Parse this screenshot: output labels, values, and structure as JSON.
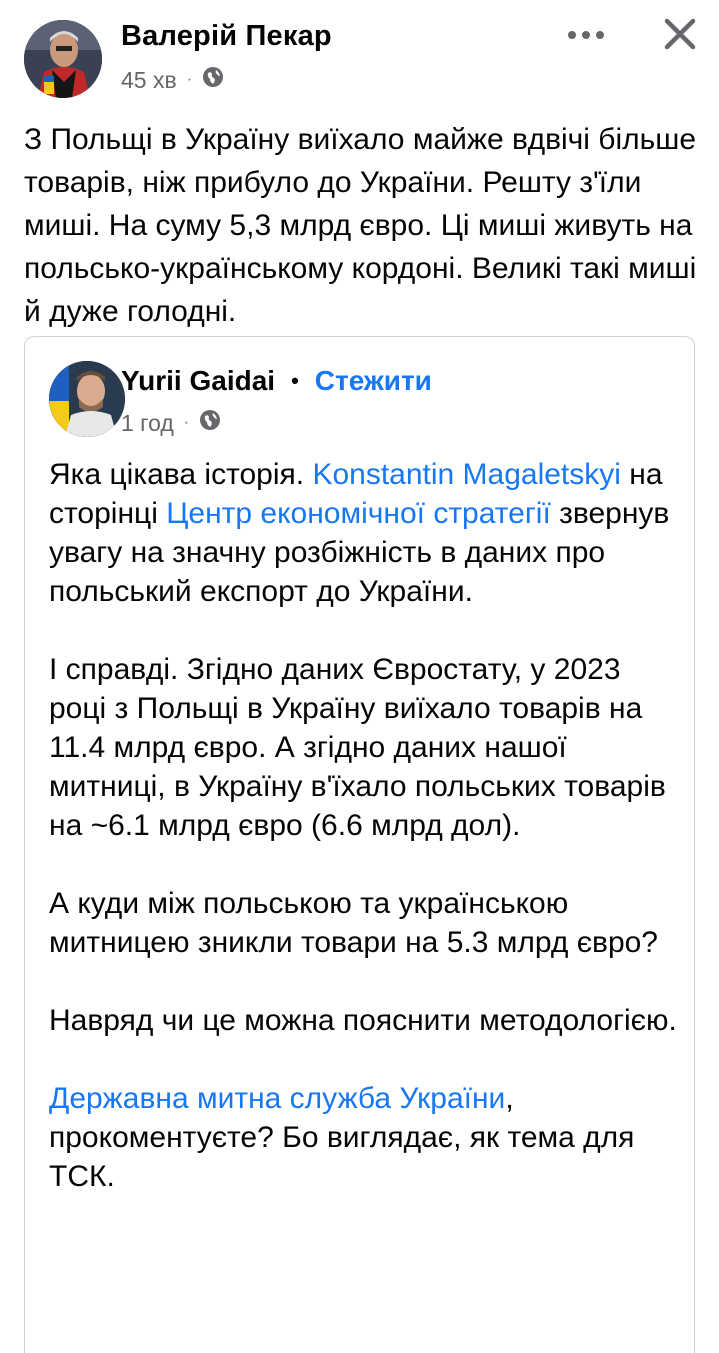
{
  "post": {
    "author": "Валерій Пекар",
    "time": "45 хв",
    "privacy_icon": "globe-icon",
    "more_icon": "more-dots-icon",
    "close_icon": "close-icon",
    "text": "З Польщі в Україну виїхало майже вдвічі більше товарів, ніж прибуло до України. Решту з'їли миші. На суму 5,3 млрд євро. Ці миші живуть на польсько-українському кордоні. Великі такі миші й дуже голодні."
  },
  "shared": {
    "author": "Yurii Gaidai",
    "separator": "•",
    "follow_label": "Стежити",
    "time": "1 год",
    "privacy_icon": "globe-icon",
    "p1": {
      "before": "Яка цікава історія. ",
      "mention1": "Konstantin Magaletskyi",
      "middle": " на сторінці ",
      "mention2": "Центр економічної стратегії",
      "after": " звернув увагу на значну розбіжність в даних про польський експорт до України."
    },
    "p2": "І справді. Згідно даних Євростату, у 2023 році з Польщі в Україну виїхало товарів на 11.4 млрд євро. А згідно даних нашої митниці, в Україну в'їхало польських товарів на ~6.1 млрд євро (6.6 млрд дол).",
    "p3": "А куди між польською та українською митницею зникли товари на 5.3 млрд євро?",
    "p4": "Навряд чи це можна пояснити методологією.",
    "p5": {
      "mention": "Державна митна служба України",
      "after": ", прокоментуєте? Бо виглядає, як тема для ТСК."
    }
  },
  "colors": {
    "link": "#1877f2",
    "meta": "#65676b",
    "text": "#050505",
    "border": "#ced0d4"
  }
}
